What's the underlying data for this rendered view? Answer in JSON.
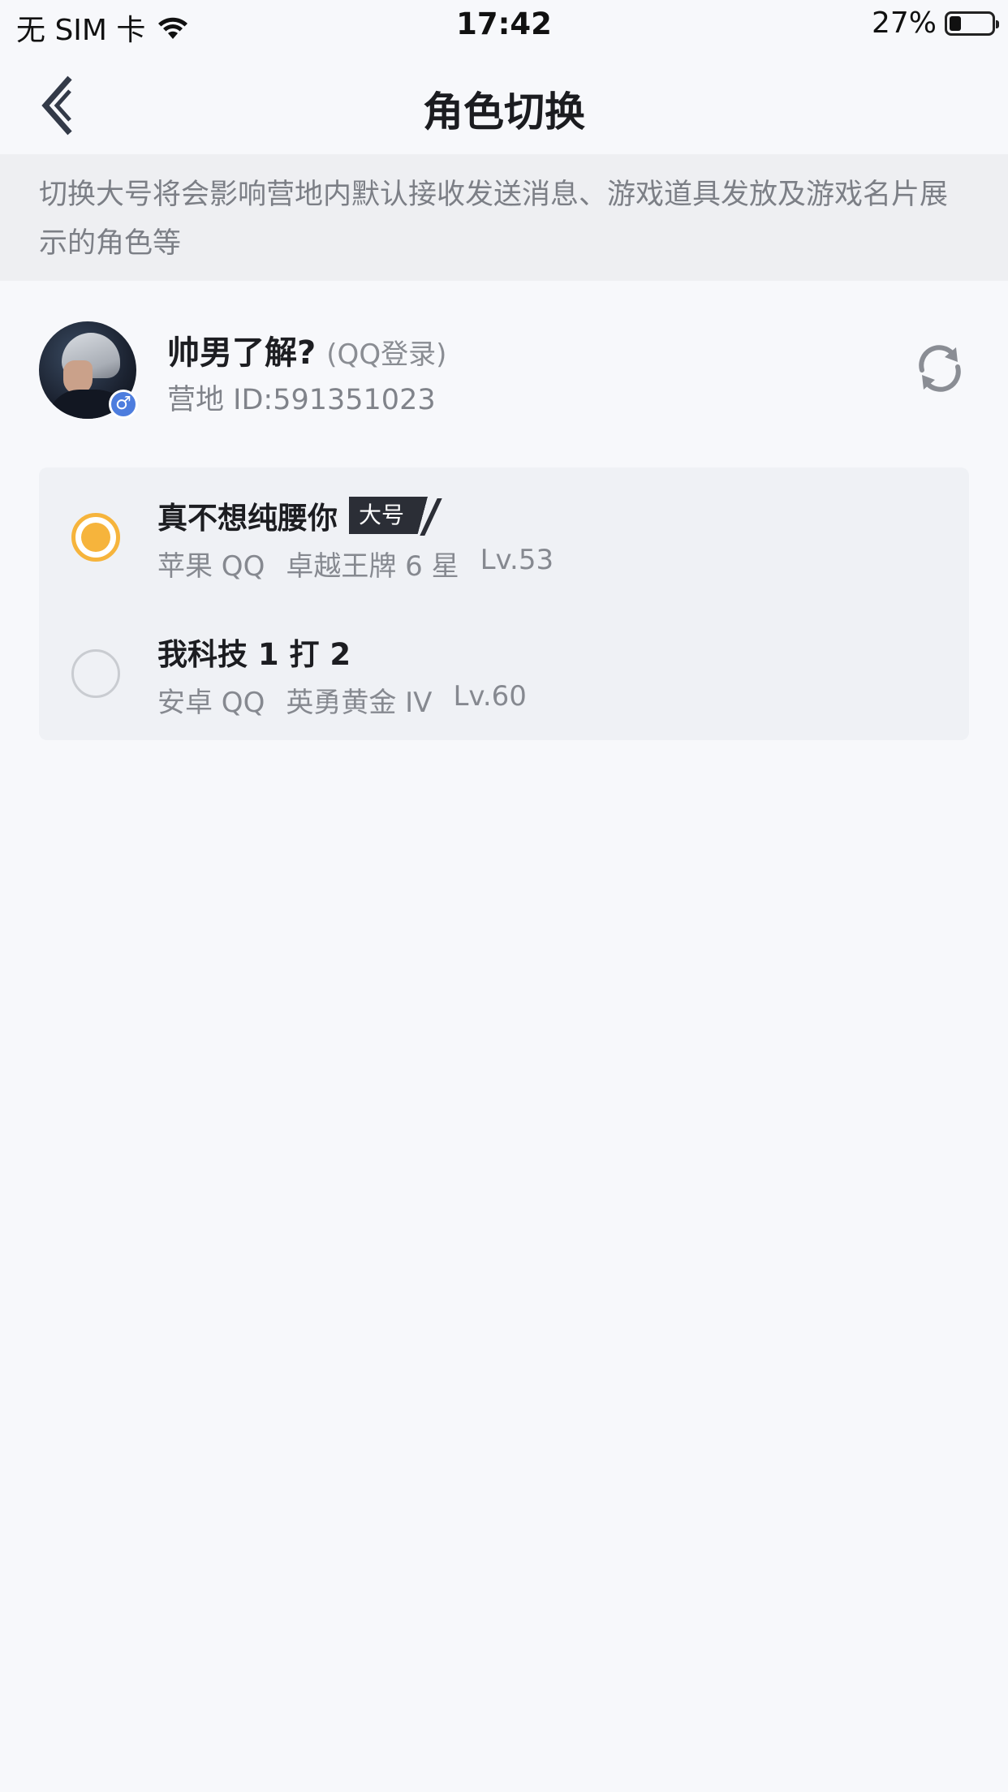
{
  "status_bar": {
    "carrier": "无 SIM 卡",
    "time": "17:42",
    "battery_percent": "27%",
    "battery_level": 0.27
  },
  "nav": {
    "title": "角色切换",
    "back_icon": "chevron-left-icon"
  },
  "notice": {
    "text": "切换大号将会影响营地内默认接收发送消息、游戏道具发放及游戏名片展示的角色等"
  },
  "profile": {
    "name": "帅男了解?",
    "login_type": "(QQ登录)",
    "camp_id": "营地 ID:591351023",
    "gender_symbol": "♂",
    "refresh_icon": "refresh-icon"
  },
  "roles": [
    {
      "name": "真不想纯腰你",
      "tag": "大号",
      "platform": "苹果 QQ",
      "rank": "卓越王牌 6 星",
      "level": "Lv.53",
      "selected": true
    },
    {
      "name": "我科技 1 打 2",
      "tag": "",
      "platform": "安卓 QQ",
      "rank": "英勇黄金 IV",
      "level": "Lv.60",
      "selected": false
    }
  ],
  "colors": {
    "accent": "#f6b43c",
    "background": "#f7f8fb",
    "notice_bg": "#eeeff2",
    "card_bg": "#eff1f5",
    "gender_badge": "#4d7dde"
  }
}
